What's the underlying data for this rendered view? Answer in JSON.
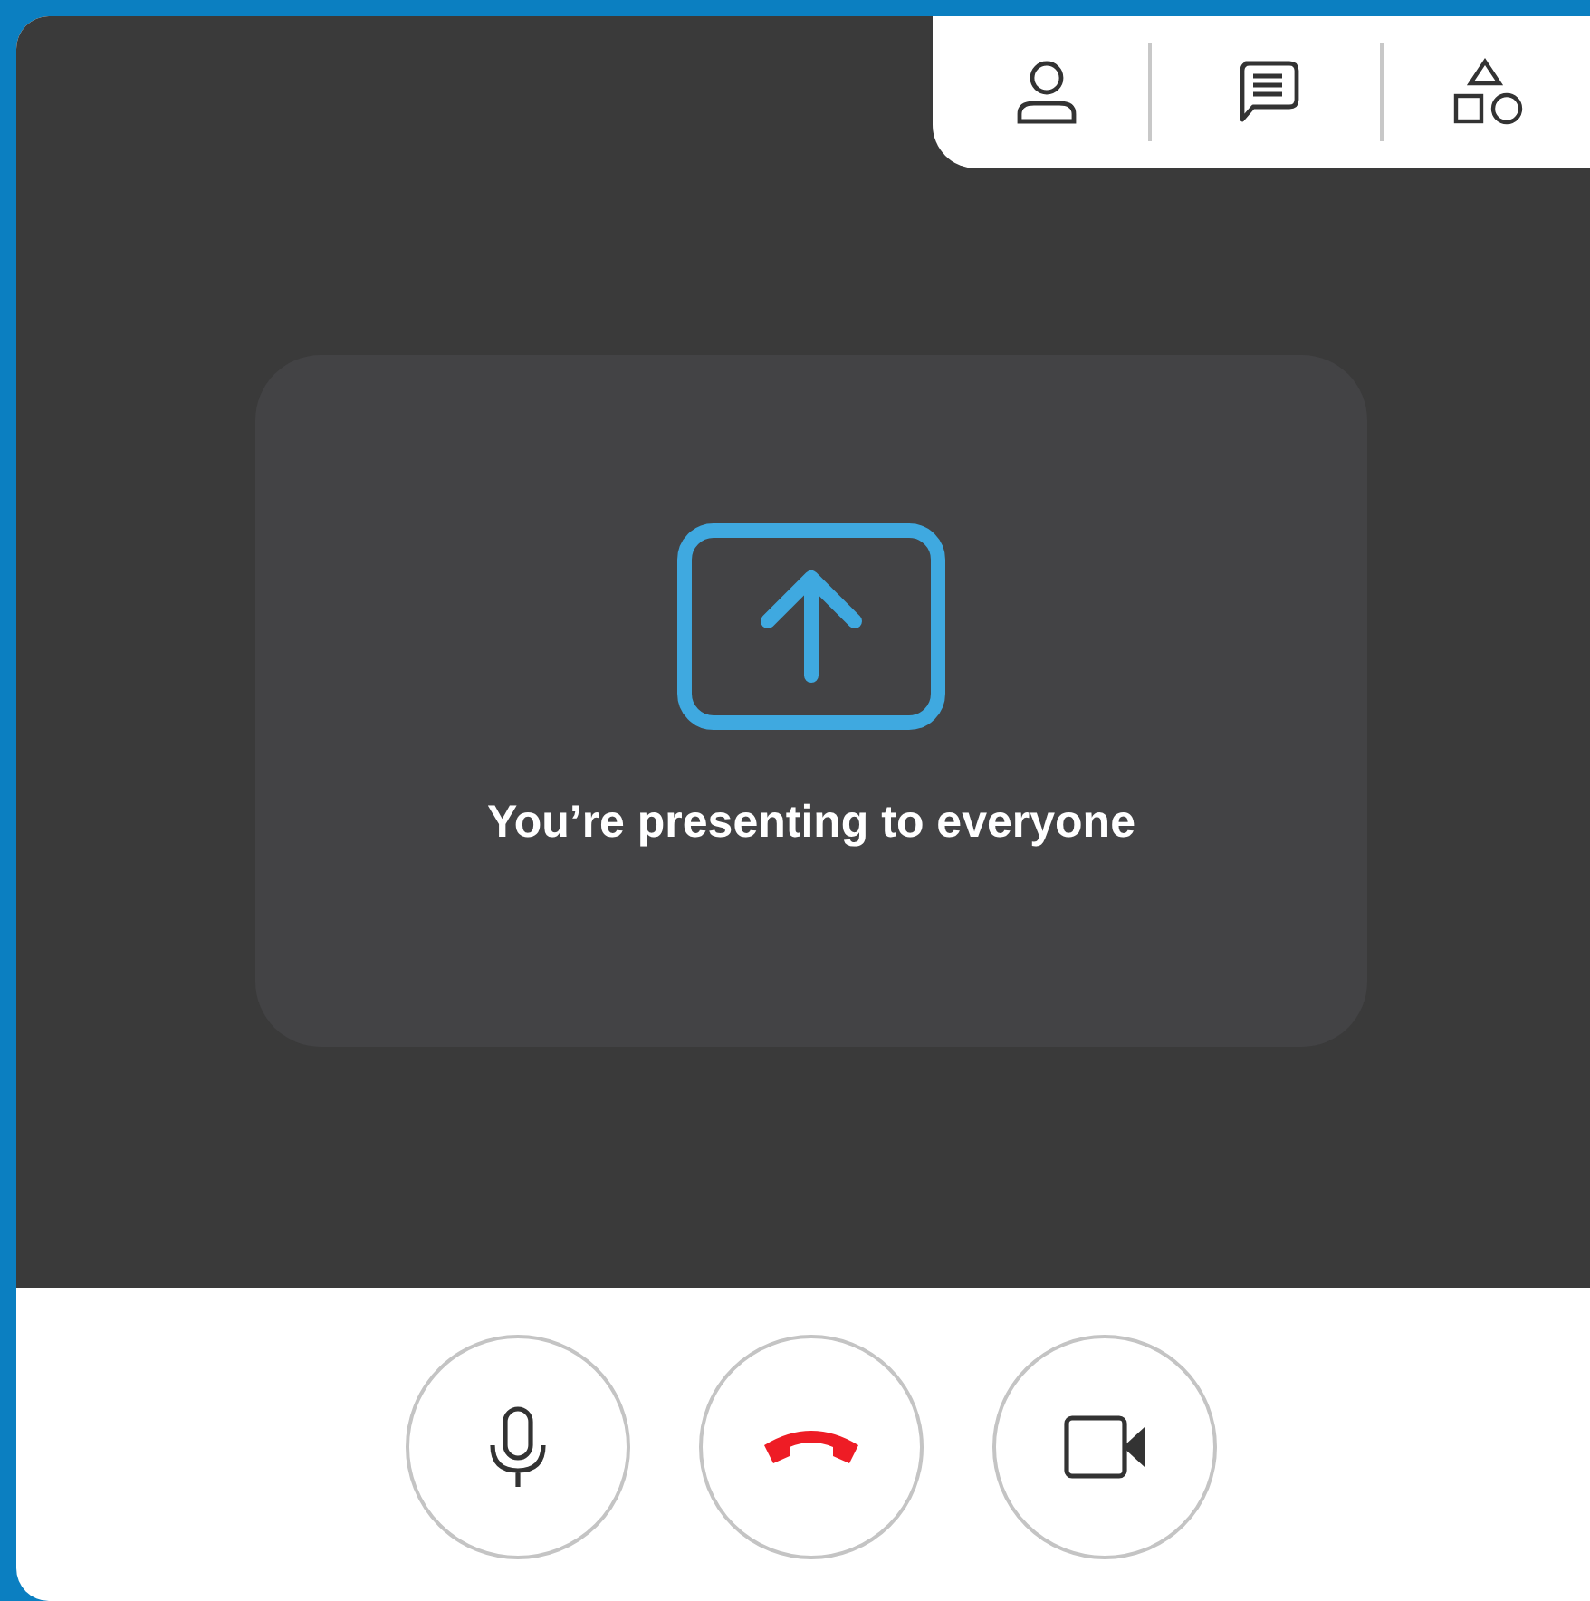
{
  "message": "You’re presenting to everyone"
}
